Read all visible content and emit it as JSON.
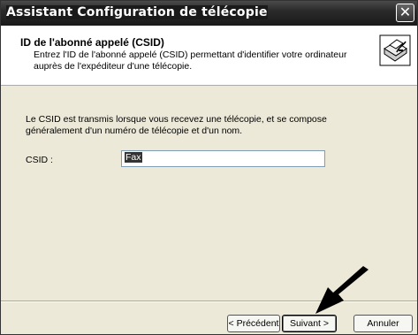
{
  "window": {
    "title": "Assistant Configuration de télécopie",
    "close_label": "✕"
  },
  "header": {
    "title": "ID de l'abonné appelé (CSID)",
    "description": "Entrez l'ID de l'abonné appelé (CSID) permettant d'identifier votre ordinateur auprès de l'expéditeur d'une télécopie.",
    "icon": "fax-machine-icon"
  },
  "content": {
    "info": "Le CSID est transmis lorsque vous recevez une télécopie, et se compose généralement d'un numéro de télécopie et d'un nom.",
    "csid_label": "CSID :",
    "csid_value": "Fax"
  },
  "buttons": {
    "previous": "< Précédent",
    "next": "Suivant >",
    "cancel": "Annuler"
  }
}
